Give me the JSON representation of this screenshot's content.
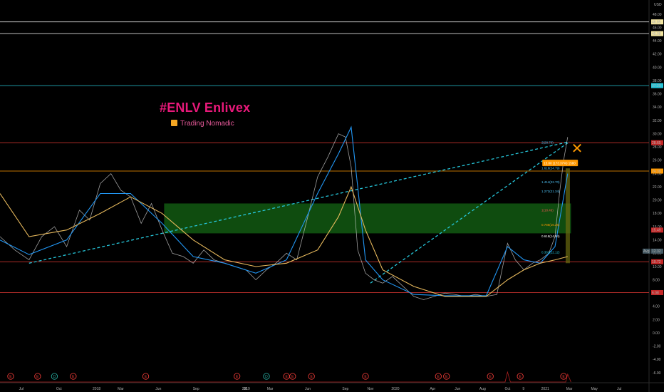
{
  "header": {
    "title": "#ENLV Enlivex",
    "subtitle": "Trading Nomadic"
  },
  "chart_data": {
    "type": "line",
    "currency": "USD",
    "ylim": [
      -7,
      49
    ],
    "y_ticks": [
      48,
      46,
      44,
      42,
      40,
      38,
      36,
      34,
      32,
      30,
      28,
      26,
      24,
      22,
      20,
      18,
      16,
      14,
      12,
      10,
      8,
      6,
      4,
      2,
      0,
      -2,
      -4,
      -6
    ],
    "y_tick_labels": [
      "48.00",
      "46.00",
      "44.00",
      "42.00",
      "40.00",
      "38.00",
      "36.00",
      "34.00",
      "32.00",
      "30.00",
      "28.00",
      "26.00",
      "24.00",
      "22.00",
      "20.00",
      "18.00",
      "16.00",
      "14.00",
      "12.00",
      "10.00",
      "8.00",
      "6.00",
      "4.00",
      "2.00",
      "0.00",
      "-2.00",
      "-4.00",
      "-6.00"
    ],
    "x_labels": [
      "Jul",
      "Oct",
      "2018",
      "Mar",
      "Jun",
      "Sep",
      "31",
      "2019",
      "Mar",
      "Jun",
      "Sep",
      "Nov",
      "2020",
      "Apr",
      "Jun",
      "Aug",
      "Oct",
      "9",
      "2021",
      "Mar",
      "May",
      "Jul"
    ],
    "x_label_dates": [
      "2017-07-01",
      "2017-10-01",
      "2018-01-01",
      "2018-03-01",
      "2018-06-01",
      "2018-09-01",
      "2018-12-31",
      "2019-01-01",
      "2019-03-01",
      "2019-06-01",
      "2019-09-01",
      "2019-11-01",
      "2020-01-01",
      "2020-04-01",
      "2020-06-01",
      "2020-08-01",
      "2020-10-01",
      "2020-11-09",
      "2021-01-01",
      "2021-03-01",
      "2021-05-01",
      "2021-07-01"
    ],
    "x_range": [
      "2017-05-10",
      "2021-09-10"
    ],
    "series": [
      {
        "style": "price",
        "color": "#e0e0e0",
        "x": [
          "2017-05-10",
          "2017-06-15",
          "2017-07-20",
          "2017-08-20",
          "2017-09-20",
          "2017-10-20",
          "2017-11-20",
          "2017-12-15",
          "2018-01-10",
          "2018-02-05",
          "2018-03-01",
          "2018-03-25",
          "2018-04-20",
          "2018-05-15",
          "2018-06-10",
          "2018-07-05",
          "2018-08-01",
          "2018-08-25",
          "2018-09-20",
          "2018-10-15",
          "2018-11-10",
          "2018-12-05",
          "2019-01-01",
          "2019-01-25",
          "2019-02-20",
          "2019-03-15",
          "2019-04-10",
          "2019-05-05",
          "2019-06-01",
          "2019-06-25",
          "2019-07-20",
          "2019-08-15",
          "2019-09-01",
          "2019-09-15",
          "2019-10-01",
          "2019-10-20",
          "2019-11-10",
          "2019-12-01",
          "2019-12-25",
          "2020-01-20",
          "2020-02-15",
          "2020-03-10",
          "2020-04-05",
          "2020-05-01",
          "2020-05-25",
          "2020-06-20",
          "2020-07-15",
          "2020-08-10",
          "2020-09-05",
          "2020-10-01",
          "2020-10-20",
          "2020-11-10",
          "2020-12-01",
          "2020-12-20",
          "2021-01-10",
          "2021-01-25",
          "2021-02-05",
          "2021-02-15",
          "2021-02-25"
        ],
        "values": [
          14.5,
          12.5,
          11.0,
          14.5,
          16.0,
          13.0,
          18.5,
          17.0,
          22.5,
          24.0,
          21.5,
          20.5,
          16.5,
          19.5,
          15.5,
          12.0,
          11.5,
          10.5,
          12.5,
          11.0,
          10.5,
          10.0,
          9.5,
          8.0,
          9.5,
          10.5,
          12.0,
          11.0,
          17.5,
          23.5,
          26.5,
          30.0,
          29.5,
          25.0,
          12.5,
          9.0,
          8.0,
          7.5,
          8.5,
          7.0,
          5.5,
          5.0,
          5.5,
          6.0,
          5.8,
          5.5,
          5.8,
          5.5,
          5.8,
          13.5,
          11.0,
          9.5,
          10.5,
          11.0,
          12.0,
          14.5,
          21.0,
          26.0,
          29.5
        ]
      },
      {
        "style": "ma-fast",
        "color": "#2196f3",
        "x": [
          "2017-05-10",
          "2017-07-20",
          "2017-10-20",
          "2018-01-10",
          "2018-03-25",
          "2018-06-10",
          "2018-08-25",
          "2018-11-10",
          "2019-01-25",
          "2019-04-10",
          "2019-06-25",
          "2019-08-15",
          "2019-09-15",
          "2019-10-01",
          "2019-10-20",
          "2019-12-01",
          "2020-02-15",
          "2020-05-01",
          "2020-08-10",
          "2020-10-01",
          "2020-11-10",
          "2020-12-20",
          "2021-01-25",
          "2021-02-25"
        ],
        "values": [
          14.0,
          11.8,
          14.0,
          21.0,
          21.0,
          16.5,
          11.5,
          10.5,
          9.0,
          11.0,
          21.0,
          27.0,
          31.0,
          22.0,
          11.0,
          8.0,
          5.8,
          5.6,
          5.6,
          13.0,
          11.0,
          10.5,
          13.0,
          24.0
        ]
      },
      {
        "style": "ma-slow",
        "color": "#e6b85c",
        "x": [
          "2017-05-10",
          "2017-07-20",
          "2017-10-20",
          "2018-01-10",
          "2018-03-25",
          "2018-06-10",
          "2018-08-25",
          "2018-11-10",
          "2019-01-25",
          "2019-04-10",
          "2019-06-25",
          "2019-08-15",
          "2019-09-15",
          "2019-10-20",
          "2019-12-01",
          "2020-02-15",
          "2020-05-01",
          "2020-08-10",
          "2020-10-01",
          "2020-11-10",
          "2020-12-20",
          "2021-01-25",
          "2021-02-25"
        ],
        "values": [
          21.0,
          14.5,
          15.5,
          18.0,
          20.5,
          18.0,
          14.0,
          11.0,
          10.0,
          10.5,
          12.5,
          17.5,
          22.0,
          15.5,
          9.5,
          7.0,
          5.5,
          5.5,
          8.0,
          9.5,
          10.5,
          11.0,
          11.5
        ]
      }
    ],
    "horizontal_lines": [
      {
        "value": 46.85,
        "label": "46.85",
        "color": "#d8d8d8",
        "label_bg": "#f3e5a0"
      },
      {
        "value": 45.08,
        "label": "45.08",
        "color": "#d8d8d8",
        "label_bg": "#f3e5a0"
      },
      {
        "value": 37.25,
        "label": "37.25",
        "color": "#26c6da",
        "label_bg": "#26c6da"
      },
      {
        "value": 28.65,
        "label": "28.65",
        "color": "#e53935",
        "label_bg": "#c62828"
      },
      {
        "value": 24.38,
        "label": "24.38",
        "color": "#ff9800",
        "label_bg": "#ff9800"
      },
      {
        "value": 10.72,
        "label": "10.72",
        "color": "#e53935",
        "label_bg": "#c62828"
      },
      {
        "value": 6.08,
        "label": "6.08",
        "color": "#e53935",
        "label_bg": "#c62828"
      }
    ],
    "price_labels": [
      {
        "value": 15.49,
        "label": "15.49",
        "label_bg": "#c62828"
      },
      {
        "value": 12.32,
        "label": "12.32",
        "label_bg": "#455a64",
        "tag": "Avg"
      }
    ],
    "green_zone": {
      "from_date": "2018-06-15",
      "to_date": "2021-03-05",
      "low": 15.0,
      "high": 19.5
    },
    "trend_lines": [
      {
        "x": [
          "2017-07-20",
          "2021-03-01"
        ],
        "y": [
          10.5,
          28.8
        ],
        "color": "#26c6da"
      },
      {
        "x": [
          "2019-11-01",
          "2021-03-01"
        ],
        "y": [
          7.5,
          28.8
        ],
        "color": "#26c6da"
      }
    ],
    "fib_levels": [
      {
        "value": 28.7,
        "label": "2(28.70)",
        "color": "#4fc3f7"
      },
      {
        "value": 24.79,
        "label": "1.618(24.79)",
        "color": "#4fc3f7"
      },
      {
        "value": 22.7,
        "label": "1.414(22.70)",
        "color": "#4fc3f7"
      },
      {
        "value": 21.34,
        "label": "1.272(21.34)",
        "color": "#4fc3f7"
      },
      {
        "value": 18.46,
        "label": "1(18.46)",
        "color": "#ef5350"
      },
      {
        "value": 16.26,
        "label": "0.786(16.26)",
        "color": "#ff9800"
      },
      {
        "value": 14.54,
        "label": "0.618(14.54)",
        "color": "#ffffff"
      },
      {
        "value": 12.12,
        "label": "0.382(12.12)",
        "color": "#26c6da"
      }
    ],
    "callout": {
      "label": "15.80 (173.37%) 1580",
      "value": 25.6,
      "color": "#ff9800"
    },
    "target_marker": {
      "x": "2021-03-20",
      "y": 27.7,
      "color": "#ff9800",
      "symbol": "✕"
    },
    "event_markers": [
      {
        "x": "2017-06-05",
        "letter": "E"
      },
      {
        "x": "2017-08-10",
        "letter": "E"
      },
      {
        "x": "2017-09-20",
        "letter": "D"
      },
      {
        "x": "2017-11-05",
        "letter": "E"
      },
      {
        "x": "2018-05-01",
        "letter": "E"
      },
      {
        "x": "2018-12-10",
        "letter": "E"
      },
      {
        "x": "2019-02-20",
        "letter": "D"
      },
      {
        "x": "2019-04-10",
        "letter": "E"
      },
      {
        "x": "2019-04-25",
        "letter": "E"
      },
      {
        "x": "2019-06-10",
        "letter": "E"
      },
      {
        "x": "2019-10-20",
        "letter": "E"
      },
      {
        "x": "2020-04-15",
        "letter": "E"
      },
      {
        "x": "2020-05-05",
        "letter": "E"
      },
      {
        "x": "2020-08-20",
        "letter": "E"
      },
      {
        "x": "2020-11-01",
        "letter": "E"
      },
      {
        "x": "2021-02-15",
        "letter": "E"
      }
    ]
  }
}
